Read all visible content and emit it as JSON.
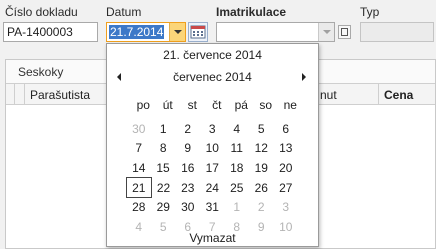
{
  "form": {
    "cislo_dokladu": {
      "label": "Číslo dokladu",
      "value": "PA-1400003"
    },
    "datum": {
      "label": "Datum",
      "value": "21.7.2014"
    },
    "imatrikulace": {
      "label": "Imatrikulace",
      "value": ""
    },
    "typ": {
      "label": "Typ",
      "value": ""
    }
  },
  "panel": {
    "title": "Seskoky",
    "columns": [
      "Parašutista",
      "nut",
      "Cena"
    ]
  },
  "calendar": {
    "full_date": "21. července 2014",
    "month_label": "červenec 2014",
    "weekdays": [
      "po",
      "út",
      "st",
      "čt",
      "pá",
      "so",
      "ne"
    ],
    "weeks": [
      [
        "30",
        "1",
        "2",
        "3",
        "4",
        "5",
        "6"
      ],
      [
        "7",
        "8",
        "9",
        "10",
        "11",
        "12",
        "13"
      ],
      [
        "14",
        "15",
        "16",
        "17",
        "18",
        "19",
        "20"
      ],
      [
        "21",
        "22",
        "23",
        "24",
        "25",
        "26",
        "27"
      ],
      [
        "28",
        "29",
        "30",
        "31",
        "1",
        "2",
        "3"
      ],
      [
        "4",
        "5",
        "6",
        "7",
        "8",
        "9",
        "10"
      ]
    ],
    "dim_cells": [
      [
        0,
        0
      ],
      [
        4,
        4
      ],
      [
        4,
        5
      ],
      [
        4,
        6
      ],
      [
        5,
        0
      ],
      [
        5,
        1
      ],
      [
        5,
        2
      ],
      [
        5,
        3
      ],
      [
        5,
        4
      ],
      [
        5,
        5
      ],
      [
        5,
        6
      ]
    ],
    "selected_cell": [
      3,
      0
    ],
    "clear_label": "Vymazat"
  },
  "colors": {
    "accent_focus": "#f0a01e",
    "selection": "#3c78c8",
    "dim_day": "#b4b4b4"
  }
}
